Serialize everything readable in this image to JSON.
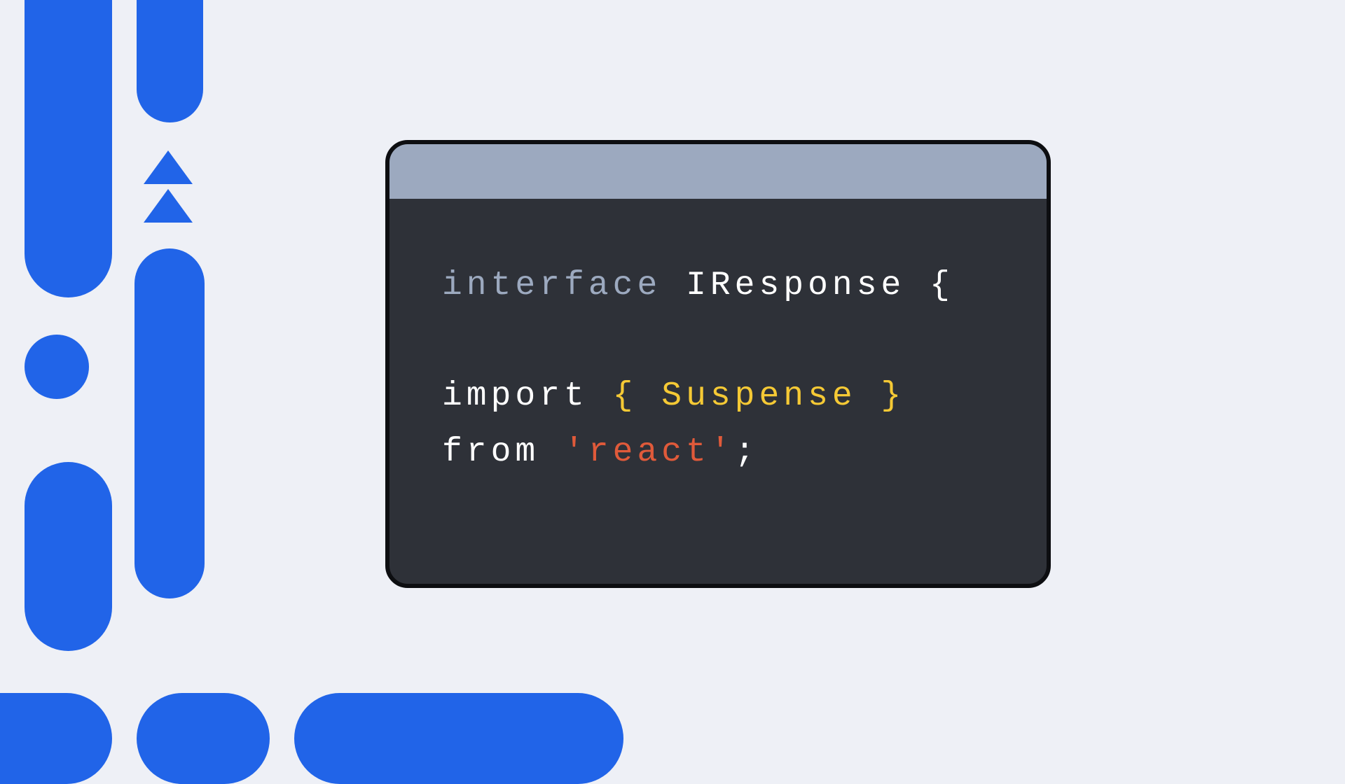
{
  "colors": {
    "background": "#eef0f6",
    "accent": "#2164e8",
    "windowBorder": "#0d0e11",
    "windowBody": "#2e3138",
    "titlebar": "#9ca9bf",
    "keywordType": "#9ca9bf",
    "identifier": "#ffffff",
    "yellow": "#f5c935",
    "string": "#e05a3a"
  },
  "code": {
    "line1": {
      "keyword": "interface",
      "name": "IResponse",
      "brace": "{"
    },
    "line2": {
      "keyword": "import",
      "braceOpen": "{",
      "name": "Suspense",
      "braceClose": "}"
    },
    "line3": {
      "keyword": "from",
      "string": "'react'",
      "semi": ";"
    }
  }
}
